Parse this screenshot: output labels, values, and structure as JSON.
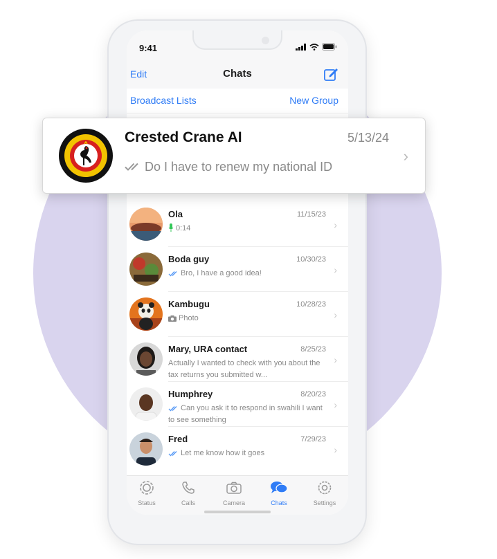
{
  "status_bar": {
    "time": "9:41"
  },
  "nav": {
    "edit_label": "Edit",
    "title": "Chats"
  },
  "lists": {
    "broadcast_label": "Broadcast Lists",
    "new_group_label": "New Group"
  },
  "featured_chat": {
    "name": "Crested Crane AI",
    "date": "5/13/24",
    "preview": "Do I have to renew my national ID",
    "avatar_icon": "uganda-crest-icon",
    "status_icon": "double-check-icon"
  },
  "chats": [
    {
      "name": "Ola",
      "date": "11/15/23",
      "preview": "0:14",
      "icon": "microphone-icon"
    },
    {
      "name": "Boda guy",
      "date": "10/30/23",
      "preview": "Bro, I have a good idea!",
      "icon": "double-check-icon"
    },
    {
      "name": "Kambugu",
      "date": "10/28/23",
      "preview": "Photo",
      "icon": "camera-icon"
    },
    {
      "name": "Mary, URA contact",
      "date": "8/25/23",
      "preview": "Actually I wanted to check with you about the tax returns you submitted w...",
      "icon": ""
    },
    {
      "name": "Humphrey",
      "date": "8/20/23",
      "preview": "Can you ask it to respond in swahili I want to see something",
      "icon": "double-check-icon"
    },
    {
      "name": "Fred",
      "date": "7/29/23",
      "preview": "Let me know how it goes",
      "icon": "double-check-icon"
    }
  ],
  "tabs": [
    {
      "label": "Status",
      "icon": "status-icon",
      "active": false
    },
    {
      "label": "Calls",
      "icon": "phone-icon",
      "active": false
    },
    {
      "label": "Camera",
      "icon": "camera-icon",
      "active": false
    },
    {
      "label": "Chats",
      "icon": "chat-bubbles-icon",
      "active": true
    },
    {
      "label": "Settings",
      "icon": "gear-icon",
      "active": false
    }
  ],
  "colors": {
    "accent": "#2f7cf6",
    "background_circle": "#d9d4ee",
    "read_check": "#5b9cf6",
    "mic": "#34c759"
  }
}
